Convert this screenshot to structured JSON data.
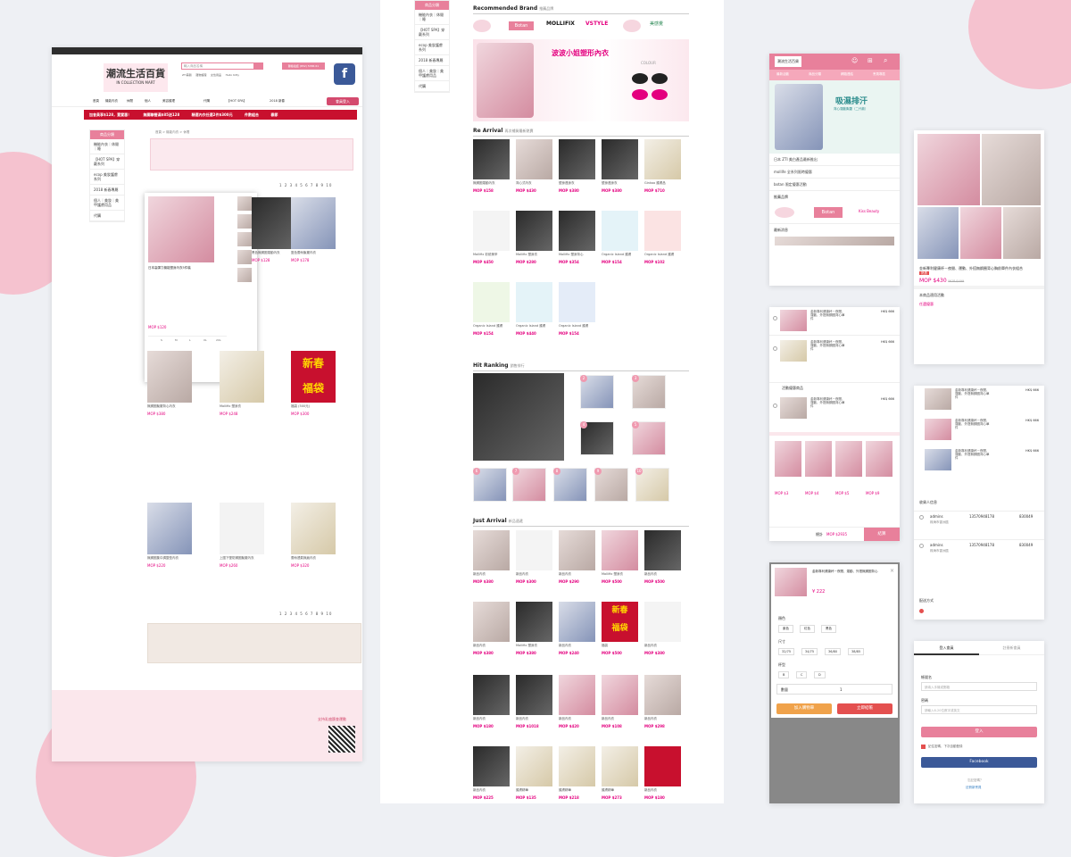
{
  "store": {
    "logo_cn": "潮流生活百貨",
    "logo_en": "IN COLLECTION MART",
    "search_placeholder": "輸入商品名稱",
    "hotline": "聯絡電話 (852) 5386 61",
    "member_btn": "會員登入",
    "promo_strip": [
      "加會員享$128，賣實惠！",
      "無關聯營滿$85送128",
      "精選內衣任選2件$300元",
      "件數組合",
      "春節"
    ],
    "hot_keywords": [
      "ZTI美體",
      "寵物護理",
      "女性用品",
      "Hello Kitty",
      "SHe is en bragit",
      "日本購物",
      "常用用品"
    ],
    "nav": [
      "首頁",
      "機能內衣",
      "休閒",
      "個人",
      "美容護理",
      "代購",
      "【HOT SPA】",
      "2018 新春"
    ],
    "breadcrumb": "首頁 > 機能內衣 > 休閒",
    "sidebar_title": "商品分類",
    "sidebar_items": [
      "機能內衣｜休閒｜睡",
      "【HOT SPA】穿戴系列",
      "ecop 美妝護膚系列",
      "2018 新春專屬",
      "個人｜美妝｜美甲護膚用品",
      "代購"
    ],
    "pagination": "1 2 3 4 5 6 7 8 9 10",
    "footer_note": "支持乳癌篩查運動"
  },
  "quickview": {
    "title": "日本高彈力機能塑身內衣5件裝",
    "price": "MOP $120",
    "sizes": [
      "S",
      "M",
      "L",
      "XL",
      "2XL"
    ],
    "add_to_cart": "加入購物車"
  },
  "home": {
    "brand_title": "Recommended Brand",
    "brand_title_cn": "推薦品牌",
    "brands": [
      "Botan",
      "MOLLIFIX",
      "VSTYLE",
      "美感覺"
    ],
    "banner_text": "波波小姐塑形內衣",
    "banner_sub": "COLOUR",
    "re_arrival": "Re Arrival",
    "re_arrival_cn": "再次補貨最新熱賣",
    "hit_ranking": "Hit Ranking",
    "hit_ranking_cn": "銷售排行",
    "just_arrival": "Just Arrival",
    "just_arrival_cn": "新品速遞",
    "prices": [
      "MOP $158",
      "MOP $430",
      "MOP $380",
      "MOP $380",
      "MOP $710",
      "MOP $450",
      "MOP $280",
      "MOP $354",
      "MOP $154",
      "MOP $102"
    ]
  },
  "mobile": {
    "title_bar": "潮流生活百貨",
    "tabs": [
      "最新活動",
      "商品分類",
      "網路連結",
      "會員專區"
    ],
    "banner_title": "吸濕排汗",
    "banner_sub": "背心運動胸罩（二代款）",
    "news_title": "最新消息",
    "brand_title": "推薦品牌",
    "brands": [
      "Botan",
      "Kiss Beauty"
    ],
    "news": [
      "日本 ZTI 美白產品最新推出",
      "mollife 全系列限時優惠",
      "botan 限定優惠活動"
    ]
  },
  "product": {
    "name": "金新專利健康杯－夜間、運動、外搭無鋼圈背心胸前單件內衣組合",
    "price": "MOP $430",
    "old_price": "MOP $499",
    "tag": "熱賣",
    "section": "本商品適用活動",
    "promo": "任選優惠"
  },
  "cart": {
    "event": "活動優惠商品",
    "item": "金新專利健康杯－夜間、運動、外搭無鋼圈背心單件",
    "price": "HK$ 666",
    "total_label": "總計",
    "total": "MOP $2935",
    "checkout": "結算",
    "addon_prices": [
      "MOP $3",
      "MOP $4",
      "MOP $5",
      "MOP $9"
    ]
  },
  "options": {
    "name": "金新專利健康杯－夜間、運動、外搭無鋼圈背心",
    "price": "¥ 222",
    "color_label": "顏色",
    "colors": [
      "紫色",
      "紅色",
      "黑色"
    ],
    "size_label": "尺寸",
    "sizes": [
      "32/75",
      "34/75",
      "36/80",
      "38/85"
    ],
    "cup_label": "杯型",
    "cups": [
      "B",
      "C",
      "D"
    ],
    "qty_label": "數量",
    "qty": "1",
    "add_cart": "加入購物車",
    "buy_now": "立即結帳"
  },
  "address": {
    "title": "收貨人信息",
    "entries": [
      {
        "name": "admins",
        "phone": "13570948178",
        "code": "830049",
        "addr": "珠海市香洲區"
      },
      {
        "name": "admins",
        "phone": "13570948178",
        "code": "830049",
        "addr": "珠海市香洲區"
      }
    ],
    "shipping_label": "配送方式"
  },
  "login": {
    "tabs": [
      "登入會員",
      "註冊新會員"
    ],
    "user_label": "帳號名",
    "user_placeholder": "請填入手機或郵箱",
    "pass_label": "密碼",
    "pass_placeholder": "請輸入6-20位數字或英文",
    "remember": "記住密碼，下次自動登錄",
    "login_btn": "登入",
    "facebook_btn": "Facebook",
    "forgot": "忘記密碼？",
    "register": "註冊新會員"
  },
  "colors": {
    "accent": "#e8809b",
    "brand": "#e4007f",
    "bg": "#eef0f4"
  }
}
